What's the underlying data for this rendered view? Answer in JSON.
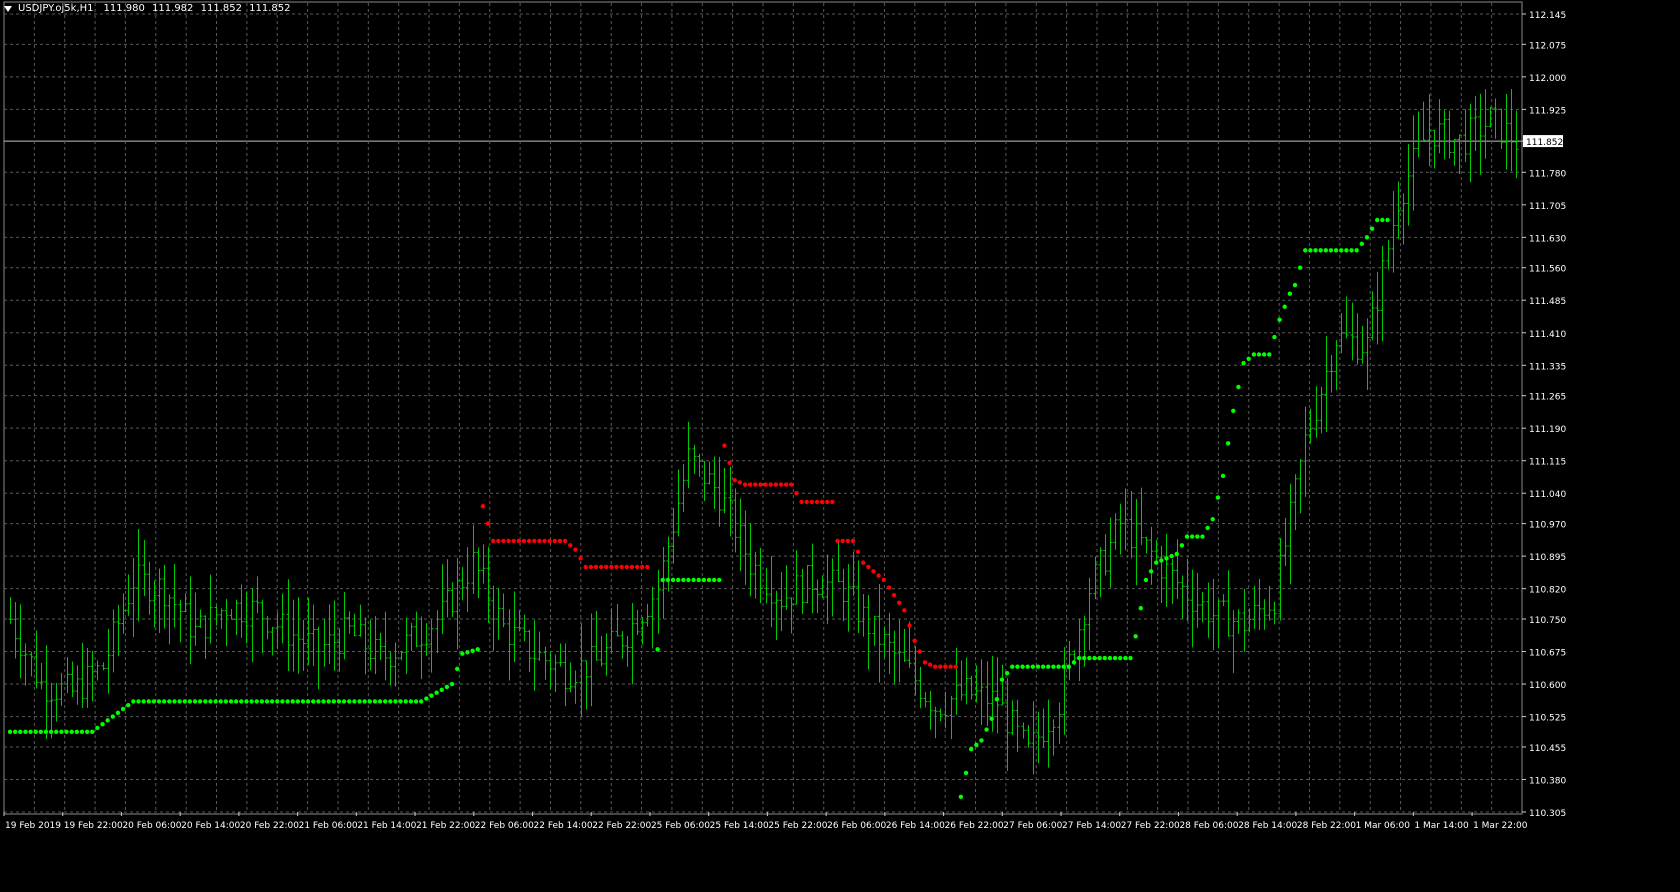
{
  "header": {
    "symbol_label": "USDJPY.oj5k,H1",
    "ohlc": [
      "111.980",
      "111.982",
      "111.852",
      "111.852"
    ]
  },
  "colors": {
    "background": "#000000",
    "grid": "#5a5a5a",
    "bars": "#00c800",
    "sar_up": "#00ff00",
    "sar_down": "#ff0000",
    "text": "#ffffff"
  },
  "chart_data": {
    "type": "ohlc-bar",
    "symbol": "USDJPY",
    "timeframe": "H1",
    "y_ticks": [
      "112.145",
      "112.075",
      "112.000",
      "111.925",
      "111.852",
      "111.780",
      "111.705",
      "111.630",
      "111.560",
      "111.485",
      "111.410",
      "111.335",
      "111.265",
      "111.190",
      "111.115",
      "111.040",
      "110.970",
      "110.895",
      "110.820",
      "110.750",
      "110.675",
      "110.600",
      "110.525",
      "110.455",
      "110.380",
      "110.305"
    ],
    "y_range": [
      110.305,
      112.145
    ],
    "current_price": "111.852",
    "x_labels": [
      "19 Feb 2019",
      "19 Feb 22:00",
      "20 Feb 06:00",
      "20 Feb 14:00",
      "20 Feb 22:00",
      "21 Feb 06:00",
      "21 Feb 14:00",
      "21 Feb 22:00",
      "22 Feb 06:00",
      "22 Feb 14:00",
      "22 Feb 22:00",
      "25 Feb 06:00",
      "25 Feb 14:00",
      "25 Feb 22:00",
      "26 Feb 06:00",
      "26 Feb 14:00",
      "26 Feb 22:00",
      "27 Feb 06:00",
      "27 Feb 14:00",
      "27 Feb 22:00",
      "28 Feb 06:00",
      "28 Feb 14:00",
      "28 Feb 22:00",
      "1 Mar 06:00",
      "1 Mar 14:00",
      "1 Mar 22:00"
    ],
    "ohlc_keypoints": [
      [
        0,
        110.75
      ],
      [
        6,
        110.6
      ],
      [
        12,
        110.58
      ],
      [
        18,
        110.64
      ],
      [
        24,
        110.84
      ],
      [
        30,
        110.82
      ],
      [
        36,
        110.72
      ],
      [
        42,
        110.78
      ],
      [
        48,
        110.77
      ],
      [
        54,
        110.72
      ],
      [
        60,
        110.68
      ],
      [
        66,
        110.72
      ],
      [
        72,
        110.66
      ],
      [
        78,
        110.7
      ],
      [
        84,
        110.76
      ],
      [
        90,
        110.88
      ],
      [
        96,
        110.73
      ],
      [
        102,
        110.67
      ],
      [
        108,
        110.63
      ],
      [
        114,
        110.65
      ],
      [
        120,
        110.72
      ],
      [
        126,
        110.82
      ],
      [
        132,
        111.12
      ],
      [
        138,
        111.04
      ],
      [
        144,
        110.88
      ],
      [
        150,
        110.8
      ],
      [
        156,
        110.84
      ],
      [
        162,
        110.82
      ],
      [
        168,
        110.72
      ],
      [
        174,
        110.64
      ],
      [
        180,
        110.55
      ],
      [
        186,
        110.58
      ],
      [
        192,
        110.56
      ],
      [
        198,
        110.44
      ],
      [
        204,
        110.56
      ],
      [
        210,
        110.82
      ],
      [
        216,
        110.97
      ],
      [
        222,
        110.9
      ],
      [
        228,
        110.82
      ],
      [
        234,
        110.76
      ],
      [
        240,
        110.74
      ],
      [
        246,
        110.8
      ],
      [
        252,
        111.16
      ],
      [
        258,
        111.4
      ],
      [
        264,
        111.38
      ],
      [
        270,
        111.72
      ],
      [
        276,
        111.88
      ],
      [
        282,
        111.85
      ],
      [
        288,
        111.9
      ],
      [
        293,
        111.852
      ]
    ],
    "sar_points": [
      [
        0,
        110.49,
        "up"
      ],
      [
        16,
        110.49,
        "up"
      ],
      [
        24,
        110.56,
        "up"
      ],
      [
        80,
        110.56,
        "up"
      ],
      [
        86,
        110.6,
        "up"
      ],
      [
        88,
        110.67,
        "up"
      ],
      [
        91,
        110.68,
        "up"
      ],
      [
        92,
        111.01,
        "down"
      ],
      [
        94,
        110.93,
        "down"
      ],
      [
        108,
        110.93,
        "down"
      ],
      [
        110,
        110.91,
        "down"
      ],
      [
        112,
        110.87,
        "down"
      ],
      [
        124,
        110.87,
        "down"
      ],
      [
        126,
        110.68,
        "up"
      ],
      [
        127,
        110.84,
        "up"
      ],
      [
        138,
        110.84,
        "up"
      ],
      [
        139,
        111.15,
        "down"
      ],
      [
        141,
        111.07,
        "down"
      ],
      [
        143,
        111.06,
        "down"
      ],
      [
        152,
        111.06,
        "down"
      ],
      [
        154,
        111.02,
        "down"
      ],
      [
        160,
        111.02,
        "down"
      ],
      [
        161,
        110.93,
        "down"
      ],
      [
        164,
        110.93,
        "down"
      ],
      [
        166,
        110.88,
        "down"
      ],
      [
        170,
        110.84,
        "down"
      ],
      [
        174,
        110.77,
        "down"
      ],
      [
        176,
        110.7,
        "down"
      ],
      [
        178,
        110.65,
        "down"
      ],
      [
        180,
        110.64,
        "down"
      ],
      [
        184,
        110.64,
        "down"
      ],
      [
        185,
        110.34,
        "up"
      ],
      [
        187,
        110.45,
        "up"
      ],
      [
        189,
        110.47,
        "up"
      ],
      [
        191,
        110.52,
        "up"
      ],
      [
        193,
        110.61,
        "up"
      ],
      [
        195,
        110.64,
        "up"
      ],
      [
        206,
        110.64,
        "up"
      ],
      [
        208,
        110.66,
        "up"
      ],
      [
        218,
        110.66,
        "up"
      ],
      [
        219,
        110.71,
        "up"
      ],
      [
        221,
        110.84,
        "up"
      ],
      [
        223,
        110.88,
        "up"
      ],
      [
        227,
        110.9,
        "up"
      ],
      [
        229,
        110.94,
        "up"
      ],
      [
        232,
        110.94,
        "up"
      ],
      [
        234,
        110.98,
        "up"
      ],
      [
        236,
        111.08,
        "up"
      ],
      [
        238,
        111.23,
        "up"
      ],
      [
        240,
        111.34,
        "up"
      ],
      [
        242,
        111.36,
        "up"
      ],
      [
        245,
        111.36,
        "up"
      ],
      [
        247,
        111.44,
        "up"
      ],
      [
        249,
        111.5,
        "up"
      ],
      [
        250,
        111.52,
        "up"
      ],
      [
        252,
        111.6,
        "up"
      ],
      [
        262,
        111.6,
        "up"
      ],
      [
        264,
        111.63,
        "up"
      ],
      [
        266,
        111.67,
        "up"
      ],
      [
        268,
        111.67,
        "up"
      ]
    ],
    "grid": true,
    "total_bars": 294
  }
}
